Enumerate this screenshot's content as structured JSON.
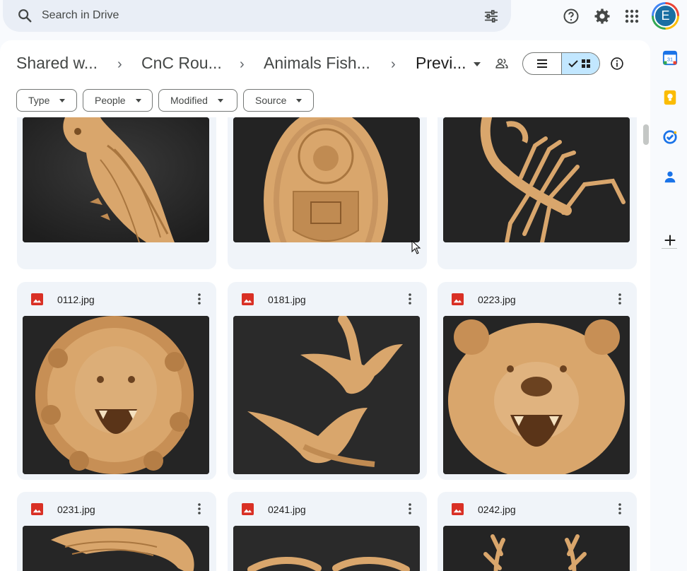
{
  "search": {
    "placeholder": "Search in Drive"
  },
  "account": {
    "initial": "E"
  },
  "breadcrumb": [
    {
      "label": "Shared w..."
    },
    {
      "label": "CnC Rou..."
    },
    {
      "label": "Animals Fish..."
    },
    {
      "label": "Previ..."
    }
  ],
  "filters": [
    {
      "label": "Type"
    },
    {
      "label": "People"
    },
    {
      "label": "Modified"
    },
    {
      "label": "Source"
    }
  ],
  "files": [
    {
      "name": "",
      "subject": "owl carving"
    },
    {
      "name": "",
      "subject": "oval crest carving"
    },
    {
      "name": "",
      "subject": "scorpion carving"
    },
    {
      "name": "0112.jpg",
      "subject": "lion head carving"
    },
    {
      "name": "0181.jpg",
      "subject": "flying ducks carving"
    },
    {
      "name": "0223.jpg",
      "subject": "bear head carving"
    },
    {
      "name": "0231.jpg",
      "subject": "wings carving"
    },
    {
      "name": "0241.jpg",
      "subject": "bird carving"
    },
    {
      "name": "0242.jpg",
      "subject": "antlers carving"
    }
  ],
  "colors": {
    "accent": "#c2e7ff",
    "image_icon": "#d93025",
    "carving": "#d9a66c",
    "thumb_bg": "#2b2b2b"
  },
  "side_icons": [
    "calendar-icon",
    "keep-icon",
    "tasks-icon",
    "contacts-icon",
    "add-icon"
  ]
}
